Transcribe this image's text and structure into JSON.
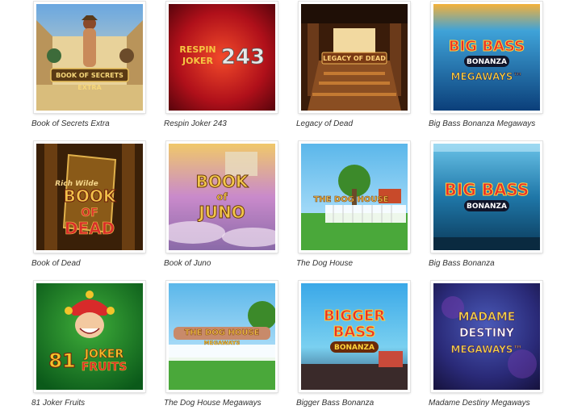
{
  "games": [
    {
      "title": "Book of Secrets Extra",
      "art_text": [
        "BOOK OF SECRETS",
        "EXTRA"
      ]
    },
    {
      "title": "Respin Joker 243",
      "art_text": [
        "RESPIN",
        "JOKER",
        "243"
      ]
    },
    {
      "title": "Legacy of Dead",
      "art_text": [
        "LEGACY OF DEAD"
      ]
    },
    {
      "title": "Big Bass Bonanza Megaways",
      "art_text": [
        "BIG BASS",
        "BONANZA",
        "MEGAWAYS™"
      ]
    },
    {
      "title": "Book of Dead",
      "art_text": [
        "Rich Wilde",
        "BOOK",
        "OF",
        "DEAD"
      ]
    },
    {
      "title": "Book of Juno",
      "art_text": [
        "BOOK",
        "of",
        "JUNO"
      ]
    },
    {
      "title": "The Dog House",
      "art_text": [
        "THE DOG HOUSE"
      ]
    },
    {
      "title": "Big Bass Bonanza",
      "art_text": [
        "BIG BASS",
        "BONANZA"
      ]
    },
    {
      "title": "81 Joker Fruits",
      "art_text": [
        "81",
        "JOKER",
        "FRUITS"
      ]
    },
    {
      "title": "The Dog House Megaways",
      "art_text": [
        "THE DOG HOUSE",
        "MEGAWAYS"
      ]
    },
    {
      "title": "Bigger Bass Bonanza",
      "art_text": [
        "BIGGER",
        "BASS",
        "BONANZA"
      ]
    },
    {
      "title": "Madame Destiny Megaways",
      "art_text": [
        "MADAME",
        "DESTINY",
        "MEGAWAYS™"
      ]
    }
  ]
}
